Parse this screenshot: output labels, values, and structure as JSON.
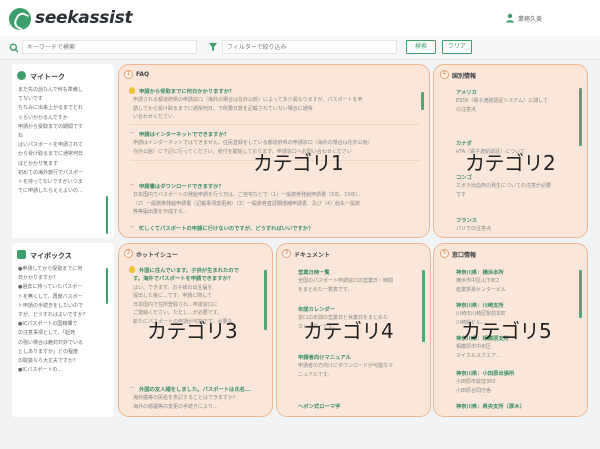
{
  "header": {
    "logo": "seekassist",
    "user_name": "業務久美"
  },
  "filterbar": {
    "search_placeholder": "キーワードで検索",
    "filter_placeholder": "フィルターで絞り込み",
    "search_button": "検索",
    "clear_button": "クリア"
  },
  "mytalk": {
    "title": "マイトーク",
    "lines": [
      "まだ先の話なんで何も準備し",
      "てないです",
      "ちなみに出来上がるまでどれ",
      "ぐらいかかるんですか",
      "申請から受取までの期間です",
      "ね",
      "はいパスポートを申請されて",
      "から受け取るまでに通常何日",
      "ほどかかり気ます",
      "初めての海外旅行でパスポー",
      "トを持ってないですがいつま",
      "でに申請したらええよいの..."
    ]
  },
  "mybox": {
    "title": "マイボックス",
    "lines": [
      "●申請してから受取までに何",
      "日かかりますか？",
      "●過去に持っていたパスポー",
      "トを無くして、再度パスポー",
      "ト申請の手続きをしたいので",
      "すが、どうすればよいですか？",
      "●ICパスポートの国籍欄で",
      "の注意事項として、「起死",
      "の強い場合は絶対対外でいる",
      "としありますか」どの程度",
      "の取扱なら大丈夫ですか？",
      "●ICパスポートの..."
    ]
  },
  "panels": {
    "faq": {
      "num": "1",
      "title": "FAQ",
      "category": "カテゴリ1",
      "items": [
        {
          "q": "申請から受取までに何日かかりますか？",
          "a": [
            "申請される都道府県の申請窓口（海外の場合は在外公館）によって多少異なりますが、パスポートを申",
            "請してから受け取るまでに通常何日、で所要日数を記載されていない場合に通常",
            "い合わせください"
          ]
        },
        {
          "q": "申請はインターネットでできますか？",
          "a": [
            "申請はインターネットではできません。住民登録をしている都道府県の申請窓口（海外の場合は在外公館）",
            "在外公館）に下記に行ってください。受付を開始しております。申請窓口へお問い合わせください"
          ]
        },
        {
          "q": "申請書はダウンロードできますか？",
          "a": [
            "日本国内でパスポートの発給申請を行う方は、ご自宅などで（1）一般旅券発給申請書（5年、10年）、",
            "（2）一般旅券発給申請書（記載事項変更用）（3）一般旅券査証欄増補申請書、及び（4）紛失一般旅",
            "券等届出書を作成する..."
          ]
        },
        {
          "q": "忙しくてパスポートの申請に行けないのですが、どうすればいいですか？",
          "a": []
        }
      ]
    },
    "country": {
      "num": "4",
      "title": "国別情報",
      "category": "カテゴリ2",
      "items": [
        {
          "q": "アメリカ",
          "a": [
            "ESTA（電子渡航認証システム）に関して",
            "の注意点"
          ]
        },
        {
          "q": "カナダ",
          "a": [
            "eTA（電子渡航認証）について"
          ]
        },
        {
          "q": "コンゴ",
          "a": [
            "エボラ出血熱の発生についての注意が必要",
            "です"
          ]
        },
        {
          "q": "フランス",
          "a": [
            "パリでの注意点"
          ]
        }
      ]
    },
    "hot": {
      "num": "2",
      "title": "ホットイシュー",
      "category": "カテゴリ3",
      "items": [
        {
          "q": "外国に住んでいます。子供が生まれたので",
          "a": []
        },
        {
          "q": "",
          "a": [
            "す。海外でパスポートを申請できますか？",
            "す。海外でパスポートを申請できますか？",
            "はい、できます。お子様の出生届を",
            "提出した後に...です。申請に際して",
            "日本国内で住所登録され...申請窓口に",
            "ご連絡ください。ただし...が必要です。",
            "新たにパスポートの申請が可能です。必要な"
          ]
        },
        {
          "q": "外国の友人婚をしました。パスポートは氏名...",
          "a": [
            "海外婚等の民名を表記することはできますか？",
            "海外の婚姻等の変更の手続きにより..."
          ]
        }
      ]
    },
    "docs": {
      "num": "3",
      "title": "ドキュメント",
      "category": "カテゴリ4",
      "items": [
        {
          "q": "営業日時一覧",
          "a": [
            "全国のパスポート申請窓口の営業日・時間",
            "をまとめた一覧表です。"
          ]
        },
        {
          "q": "年間カレンダー",
          "a": [
            "窓口の年間の営業日と休業日をまとめた",
            "カレンダーです。"
          ]
        },
        {
          "q": "申請者向けマニュアル",
          "a": [
            "申請者の方向けにダウンロードが可能なマ",
            "ニュアルです。"
          ]
        },
        {
          "q": "ヘボン式ローマ字",
          "a": []
        }
      ]
    },
    "window": {
      "num": "5",
      "title": "窓口情報",
      "category": "カテゴリ5",
      "items": [
        {
          "q": "神奈川県：横浜本所",
          "a": [
            "横浜市中区山下町2",
            "産業貿易センタービル"
          ]
        },
        {
          "q": "神奈川県：川崎支所",
          "a": [
            "川崎市川崎区駅前本町",
            "川崎駅ビル..."
          ]
        },
        {
          "q": "神奈川県：相模原支所",
          "a": [
            "相模原市中央区",
            "マイカルスクエア..."
          ]
        },
        {
          "q": "神奈川県：小田原出張所",
          "a": [
            "小田原市荻窪300",
            "小田原合同庁舎"
          ]
        },
        {
          "q": "神奈川県：県央支所（厚木）",
          "a": []
        }
      ]
    }
  }
}
